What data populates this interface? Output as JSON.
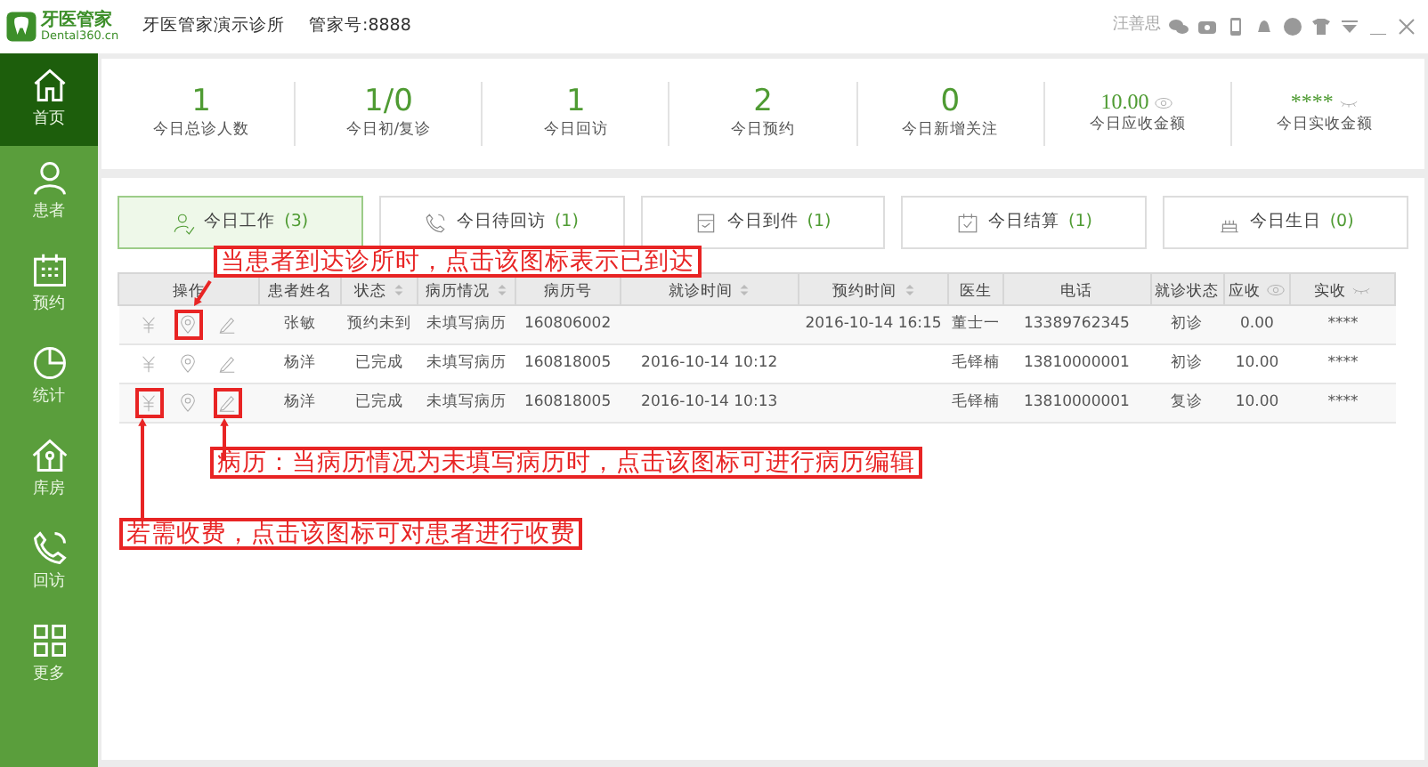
{
  "titlebar": {
    "logo_text": "牙医管家",
    "logo_sub": "Dental360.cn",
    "clinic": "牙医管家演示诊所",
    "account": "管家号:8888",
    "user": "汪善思"
  },
  "sidebar": {
    "items": [
      {
        "label": "首页",
        "selected": true
      },
      {
        "label": "患者",
        "selected": false
      },
      {
        "label": "预约",
        "selected": false
      },
      {
        "label": "统计",
        "selected": false
      },
      {
        "label": "库房",
        "selected": false
      },
      {
        "label": "回访",
        "selected": false
      },
      {
        "label": "更多",
        "selected": false
      }
    ]
  },
  "stats": [
    {
      "value": "1",
      "label": "今日总诊人数",
      "kind": "number"
    },
    {
      "value": "1/0",
      "label": "今日初/复诊",
      "kind": "number"
    },
    {
      "value": "1",
      "label": "今日回访",
      "kind": "number"
    },
    {
      "value": "2",
      "label": "今日预约",
      "kind": "number"
    },
    {
      "value": "0",
      "label": "今日新增关注",
      "kind": "number"
    },
    {
      "value": "10.00",
      "label": "今日应收金额",
      "kind": "money-shown"
    },
    {
      "value": "****",
      "label": "今日实收金额",
      "kind": "money-hidden"
    }
  ],
  "tabs": [
    {
      "label": "今日工作",
      "count": "(3)",
      "selected": true
    },
    {
      "label": "今日待回访",
      "count": "(1)",
      "selected": false
    },
    {
      "label": "今日到件",
      "count": "(1)",
      "selected": false
    },
    {
      "label": "今日结算",
      "count": "(1)",
      "selected": false
    },
    {
      "label": "今日生日",
      "count": "(0)",
      "selected": false
    }
  ],
  "table": {
    "action_column": {
      "label": "操作"
    },
    "columns": [
      {
        "label": "患者姓名",
        "sortable": false,
        "kind": "plain"
      },
      {
        "label": "状态",
        "sortable": true,
        "kind": "plain"
      },
      {
        "label": "病历情况",
        "sortable": true,
        "kind": "plain"
      },
      {
        "label": "病历号",
        "sortable": false,
        "kind": "plain"
      },
      {
        "label": "就诊时间",
        "sortable": true,
        "kind": "plain"
      },
      {
        "label": "预约时间",
        "sortable": true,
        "kind": "plain"
      },
      {
        "label": "医生",
        "sortable": false,
        "kind": "plain"
      },
      {
        "label": "电话",
        "sortable": false,
        "kind": "plain"
      },
      {
        "label": "就诊状态",
        "sortable": false,
        "kind": "plain"
      },
      {
        "label": "应收",
        "sortable": false,
        "kind": "amount-shown"
      },
      {
        "label": "实收",
        "sortable": false,
        "kind": "amount-hidden"
      }
    ],
    "rows": [
      {
        "actions": [
          {
            "kind": "charge",
            "highlighted": false
          },
          {
            "kind": "arrive",
            "highlighted": true
          },
          {
            "kind": "edit",
            "highlighted": false
          }
        ],
        "cells": [
          "张敏",
          "预约未到",
          "未填写病历",
          "160806002",
          "",
          "2016-10-14 16:15",
          "董士一",
          "13389762345",
          "初诊",
          "0.00",
          "****"
        ]
      },
      {
        "actions": [
          {
            "kind": "charge",
            "highlighted": false
          },
          {
            "kind": "arrive",
            "highlighted": false
          },
          {
            "kind": "edit",
            "highlighted": false
          }
        ],
        "cells": [
          "杨洋",
          "已完成",
          "未填写病历",
          "160818005",
          "2016-10-14 10:12",
          "",
          "毛铎楠",
          "13810000001",
          "初诊",
          "10.00",
          "****"
        ]
      },
      {
        "actions": [
          {
            "kind": "charge",
            "highlighted": true
          },
          {
            "kind": "arrive",
            "highlighted": false
          },
          {
            "kind": "edit",
            "highlighted": true
          }
        ],
        "cells": [
          "杨洋",
          "已完成",
          "未填写病历",
          "160818005",
          "2016-10-14 10:13",
          "",
          "毛铎楠",
          "13810000001",
          "复诊",
          "10.00",
          "****"
        ]
      }
    ]
  },
  "callouts": [
    {
      "text": "当患者到达诊所时，点击该图标表示已到达"
    },
    {
      "text": "病历：当病历情况为未填写病历时，点击该图标可进行病历编辑"
    },
    {
      "text": "若需收费，点击该图标可对患者进行收费"
    }
  ]
}
